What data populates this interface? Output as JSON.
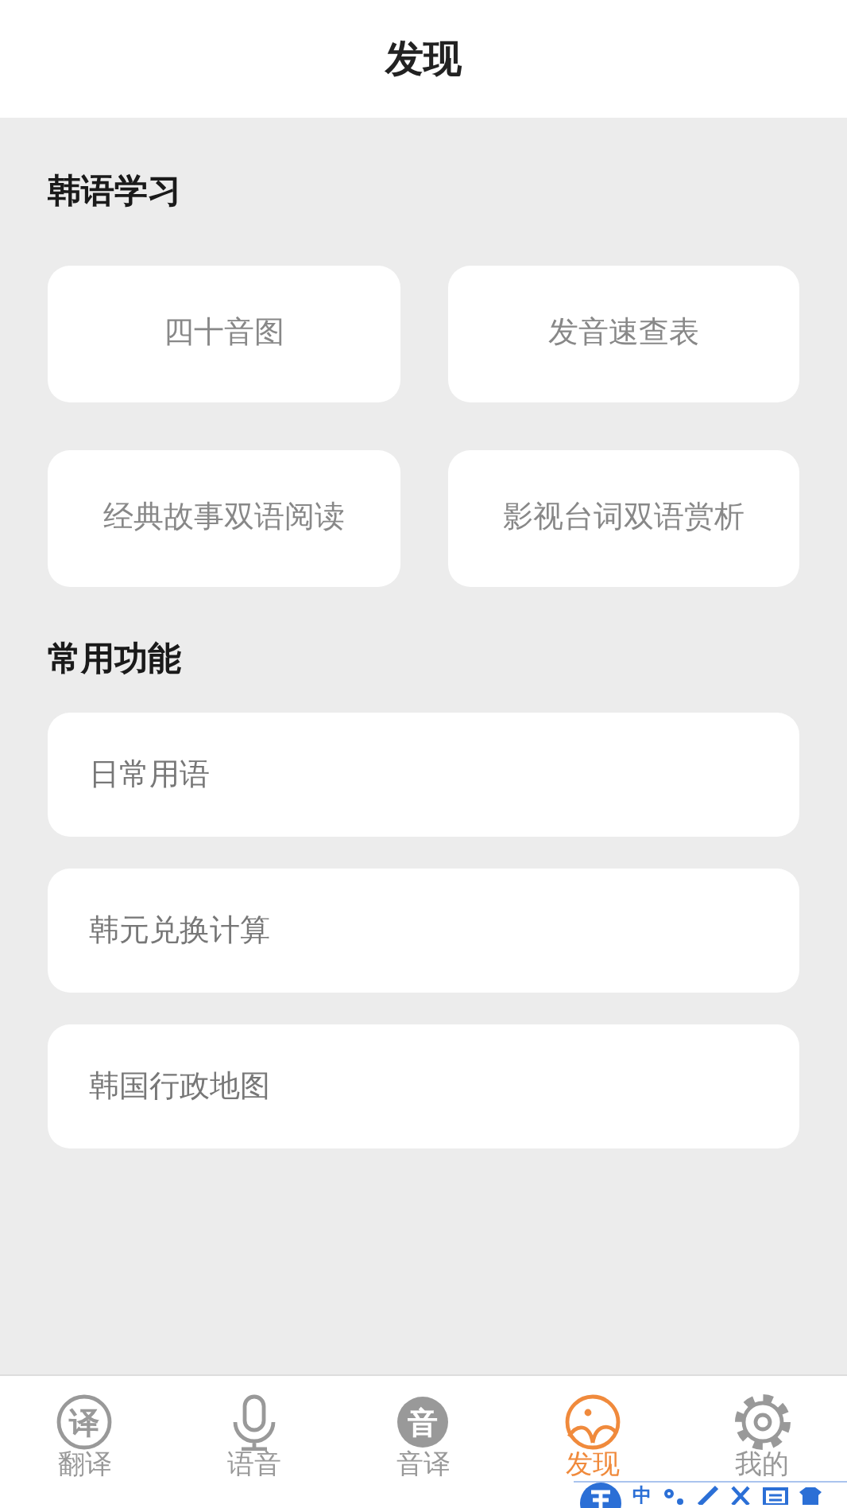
{
  "header": {
    "title": "发现"
  },
  "sections": [
    {
      "title": "韩语学习",
      "kind": "grid",
      "items": [
        "四十音图",
        "发音速查表",
        "经典故事双语阅读",
        "影视台词双语赏析"
      ]
    },
    {
      "title": "常用功能",
      "kind": "list",
      "items": [
        "日常用语",
        "韩元兑换计算",
        "韩国行政地图"
      ]
    }
  ],
  "tabs": [
    {
      "label": "翻译",
      "kind": "circle-char",
      "icon_text": "译",
      "selected": false
    },
    {
      "label": "语音",
      "kind": "mic",
      "selected": false
    },
    {
      "label": "音译",
      "kind": "filled-char",
      "icon_text": "音",
      "selected": false
    },
    {
      "label": "发现",
      "kind": "discover",
      "selected": true
    },
    {
      "label": "我的",
      "kind": "gear",
      "selected": false
    }
  ],
  "ime_toolbar": {
    "mode": "中"
  }
}
